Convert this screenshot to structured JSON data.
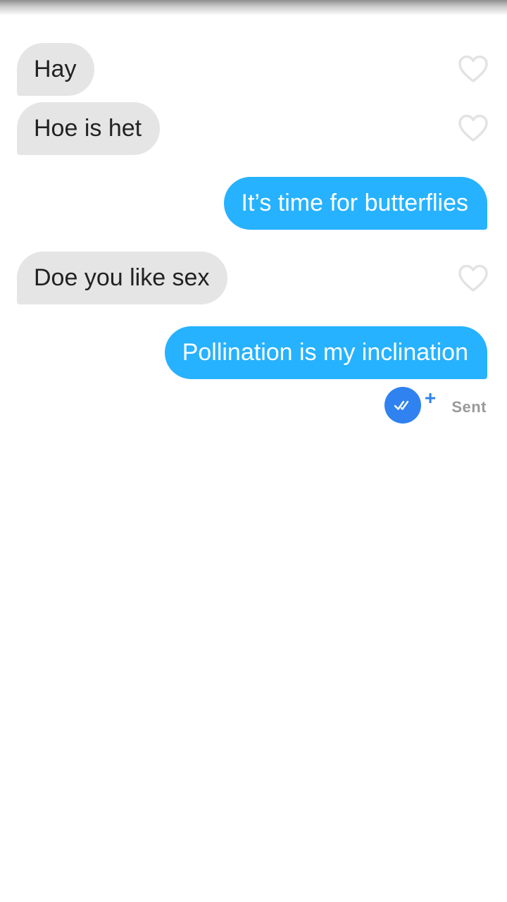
{
  "conversation": {
    "messages": [
      {
        "sender": "match",
        "text": "Hay",
        "liked": false
      },
      {
        "sender": "match",
        "text": "Hoe is het",
        "liked": false
      },
      {
        "sender": "me",
        "text": "It’s time for butterflies"
      },
      {
        "sender": "match",
        "text": "Doe you like sex",
        "liked": false
      },
      {
        "sender": "me",
        "text": "Pollination is my inclination"
      }
    ],
    "last_message_status": "Sent",
    "plus_symbol": "+",
    "icons": {
      "like": "heart-outline-icon",
      "receipt": "double-check-icon",
      "add": "plus-icon"
    },
    "colors": {
      "sent_bubble": "#26b2ff",
      "received_bubble": "#e5e5e5",
      "receipt_badge": "#2f82f0",
      "heart_outline": "#e3e3e3",
      "status_text": "#9a9a9a"
    }
  }
}
